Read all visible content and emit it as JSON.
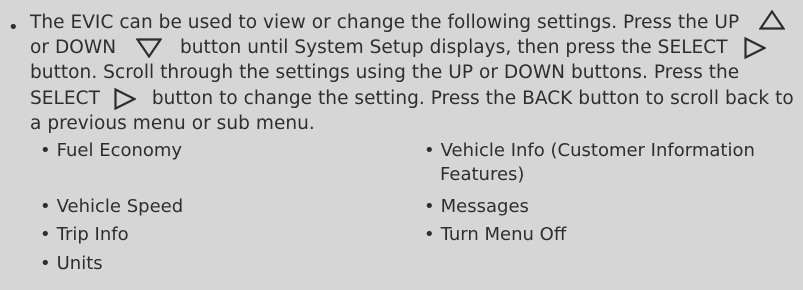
{
  "intro": {
    "line1_a": "The EVIC can be used to view or change the following settings. Press the UP",
    "line2_a": "or DOWN",
    "line2_b": "button until System Setup displays, then press the SELECT",
    "line3": "button. Scroll through the settings using the UP or DOWN buttons. Press the",
    "line4_a": "SELECT",
    "line4_b": "button to change the setting. Press the BACK button to scroll back to",
    "line5": "a previous menu or sub menu."
  },
  "icons": {
    "up": "triangle-up-icon",
    "down": "triangle-down-icon",
    "select": "triangle-right-icon"
  },
  "settings_left": [
    "Fuel Economy",
    "Vehicle Speed",
    "Trip Info",
    "Units"
  ],
  "settings_right": {
    "vehicle_info_line1": "Vehicle Info (Customer Information",
    "vehicle_info_line2": "Features)",
    "messages": "Messages",
    "turn_menu_off": "Turn Menu Off"
  },
  "colors": {
    "background": "#d6d6d6",
    "text": "#2e2e2e"
  }
}
